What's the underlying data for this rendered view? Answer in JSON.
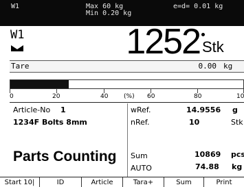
{
  "status_bar": {
    "scale_id": "W1",
    "max": "Max 60 kg",
    "min": "Min 0.20 kg",
    "e_d": "e=d= 0.01 kg"
  },
  "weight": {
    "label": "W1",
    "value": "1252",
    "unit": "Stk"
  },
  "tare": {
    "label": "Tare",
    "value": "0.00",
    "unit": "kg"
  },
  "capacity_bar": {
    "fill_percent": 25,
    "ticks": [
      "0",
      "20",
      "40",
      "(%)",
      "60",
      "80",
      "100"
    ]
  },
  "info": {
    "article_label": "Article-No",
    "article_no": "1",
    "article_name": "1234F Bolts 8mm",
    "mode_title": "Parts Counting",
    "wref_label": "wRef.",
    "wref_value": "14.9556",
    "wref_unit": "g",
    "nref_label": "nRef.",
    "nref_value": "10",
    "nref_unit": "Stk",
    "sum_label": "Sum",
    "sum_value": "10869",
    "sum_unit": "pcs",
    "auto_label": "AUTO",
    "auto_value": "74.88",
    "auto_unit": "kg"
  },
  "softkeys": [
    {
      "label": "Start 10|"
    },
    {
      "label": "ID"
    },
    {
      "label": "Article"
    },
    {
      "label": "Tara+"
    },
    {
      "label": "Sum"
    },
    {
      "label": "Print"
    }
  ],
  "colors": {
    "status_bar_bg": "#0a0a0a",
    "bar_fill": "#111111"
  }
}
